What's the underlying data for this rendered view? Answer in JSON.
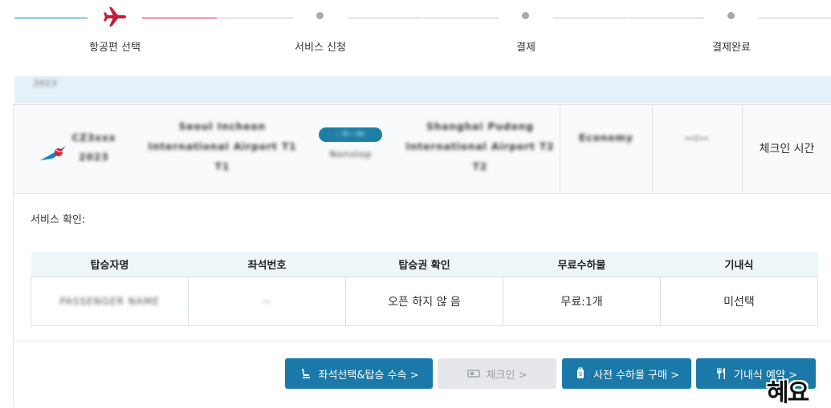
{
  "stepper": {
    "steps": [
      {
        "label": "항공편 선택",
        "state": "active",
        "icon": "airplane-icon"
      },
      {
        "label": "서비스 신청",
        "state": "pending"
      },
      {
        "label": "결제",
        "state": "pending"
      },
      {
        "label": "결제완료",
        "state": "pending"
      }
    ],
    "colors": {
      "done": "#1a7fa8",
      "active": "#c41e3a",
      "pending": "#bfc6cc"
    }
  },
  "flight": {
    "airline_logo": "airline-logo-icon",
    "flight_no": "CZ3xxx",
    "flight_date": "2023",
    "departure": {
      "name": "Seoul Incheon",
      "airport": "International Airport T1",
      "terminal": "T1"
    },
    "duration_badge": "--h--m",
    "duration_text": "Nonstop",
    "arrival": {
      "name": "Shanghai Pudong",
      "airport": "International Airport T2",
      "terminal": "T2"
    },
    "col_a": "Economy",
    "col_b": "--:--",
    "checkin_time_label": "체크인 시간"
  },
  "service": {
    "title": "서비스 확인:",
    "columns": [
      "탑승자명",
      "좌석번호",
      "탑승권 확인",
      "무료수하물",
      "기내식"
    ],
    "rows": [
      {
        "passenger": "PASSENGER NAME",
        "seat": "--",
        "boarding_pass": "오픈 하지 않 음",
        "baggage": "무료:1개",
        "meal": "미선택"
      }
    ]
  },
  "actions": [
    {
      "label": "좌석선택&탑승 수속 >",
      "icon": "seat-icon",
      "enabled": true
    },
    {
      "label": "체크인 >",
      "icon": "ticket-icon",
      "enabled": false
    },
    {
      "label": "사전 수하물 구매 >",
      "icon": "luggage-icon",
      "enabled": true
    },
    {
      "label": "기내식 예약 >",
      "icon": "fork-knife-icon",
      "enabled": true
    }
  ],
  "watermark": "혜요",
  "accent_color": "#1a79a8"
}
